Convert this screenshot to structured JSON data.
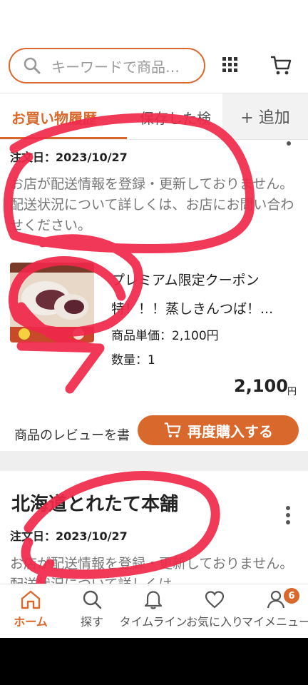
{
  "search": {
    "placeholder": "キーワードで商品…",
    "icon": "search-icon"
  },
  "header_icons": [
    "grid-icon",
    "cart-icon"
  ],
  "tabs": [
    {
      "label": "お買い物履歴",
      "active": true
    },
    {
      "label": "保存した検"
    }
  ],
  "add_tab_label": "+ 追加",
  "order1": {
    "date": "注文日：2023/10/27",
    "notice": "お店が配送情報を登録・更新しておりません。配送状況について詳しくは、お店にお問い合わせください。",
    "product_name": "プレミアム限定クーポン特！！！蒸しきんつば！...",
    "unit_price": "商品単価：2,100円",
    "quantity": "数量：1",
    "total": "2,100",
    "total_unit": "円",
    "review_link": "商品のレビューを書",
    "rebuy_label": "再度購入する"
  },
  "order2": {
    "shop_name": "北海道とれたて本舗",
    "date": "注文日：2023/10/27",
    "notice": "お店が配送情報を登録・更新しておりません。配送状況について詳しくは"
  },
  "bottom_nav": [
    {
      "label": "ホーム",
      "icon": "home-icon",
      "active": true
    },
    {
      "label": "探す",
      "icon": "search-icon"
    },
    {
      "label": "タイムライン",
      "icon": "bell-icon"
    },
    {
      "label": "お気に入り",
      "icon": "heart-icon"
    },
    {
      "label": "マイメニュー",
      "icon": "user-icon",
      "badge": "6"
    }
  ],
  "colors": {
    "accent": "#d9682c",
    "annotation": "#f0284a"
  }
}
